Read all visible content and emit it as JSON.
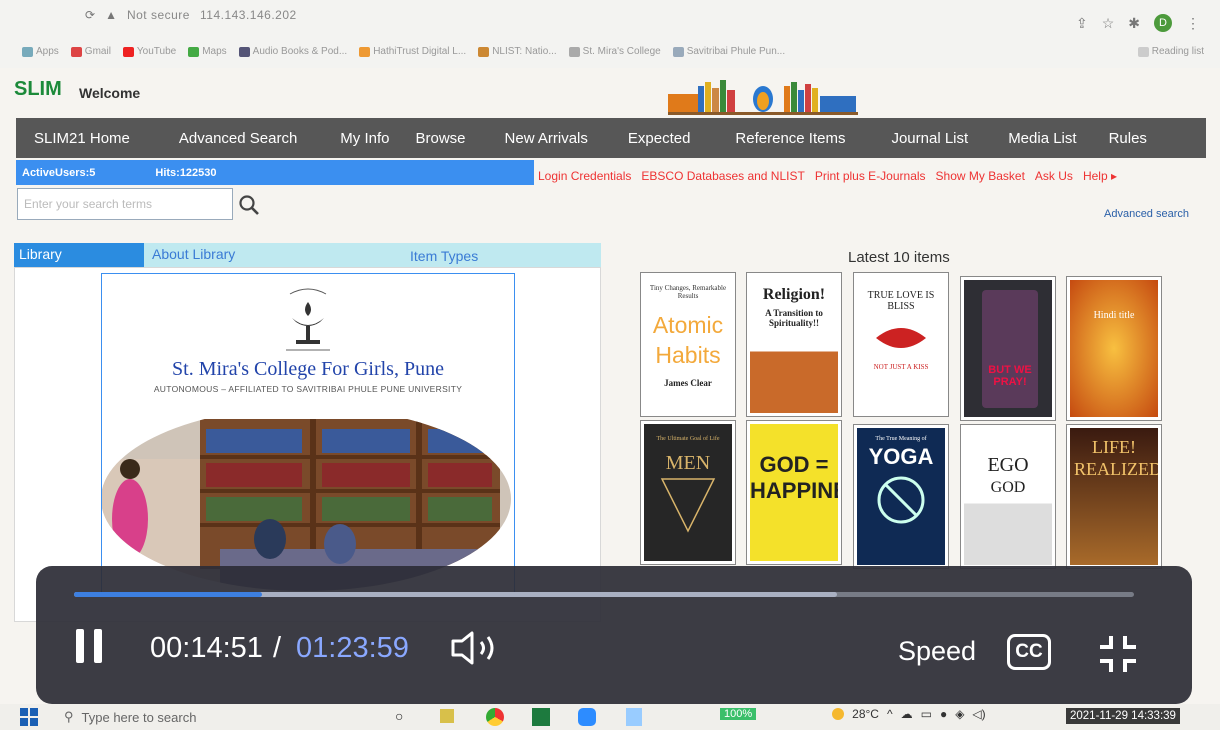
{
  "browser": {
    "address": "114.143.146.202",
    "address_prefix": "Not secure",
    "bookmarks": [
      "Apps",
      "Gmail",
      "YouTube",
      "Maps",
      "Audio Books & Pod...",
      "HathiTrust Digital L...",
      "NLIST: Natio...",
      "St. Mira's College",
      "Savitribai Phule Pun...",
      "Reading list"
    ],
    "avatar_letter": "D"
  },
  "header": {
    "logo": "SLIM",
    "welcome": "Welcome"
  },
  "nav": {
    "items": [
      "SLIM21 Home",
      "Advanced Search",
      "My Info",
      "Browse",
      "New Arrivals",
      "Expected",
      "Reference Items",
      "Journal List",
      "Media List",
      "Rules"
    ]
  },
  "info": {
    "active_users": "ActiveUsers:5",
    "hits": "Hits:122530"
  },
  "links": [
    "Login Credentials",
    "EBSCO Databases and NLIST",
    "Print plus E-Journals",
    "Show My Basket",
    "Ask Us",
    "Help ▸"
  ],
  "search": {
    "placeholder": "Enter your search terms",
    "advanced": "Advanced search"
  },
  "tabs": {
    "library": "Library",
    "about": "About Library",
    "item_types": "Item Types"
  },
  "college": {
    "name": "St. Mira's College For Girls, Pune",
    "subtitle": "AUTONOMOUS – AFFILIATED TO SAVITRIBAI PHULE PUNE UNIVERSITY"
  },
  "latest": {
    "title": "Latest 10 items",
    "books": [
      {
        "top": "Tiny Changes, Remarkable Results",
        "title": "Atomic Habits",
        "author": "James Clear"
      },
      {
        "title": "Religion!",
        "sub": "A Transition to Spirituality!!"
      },
      {
        "title": "TRUE LOVE IS BLISS",
        "sub": "NOT JUST A KISS"
      },
      {
        "title": "BUT WE PRAY!"
      },
      {
        "title": "Hindi title"
      },
      {
        "top": "The Ultimate Goal of Life",
        "title": "MEN"
      },
      {
        "title": "GOD = HAPPINESS"
      },
      {
        "top": "The True Meaning of",
        "title": "YOGA"
      },
      {
        "title": "EGO",
        "sub": "GOD"
      },
      {
        "title": "LIFE! REALIZED!!"
      }
    ]
  },
  "player": {
    "current": "00:14:51",
    "separator": "/",
    "total": "01:23:59",
    "speed": "Speed",
    "cc": "CC",
    "played": 0.177,
    "buffered": 0.72
  },
  "taskbar": {
    "search": "Type here to search",
    "zoom": "100%",
    "temp": "28°C",
    "clock": "2021-11-29 14:33:39"
  }
}
